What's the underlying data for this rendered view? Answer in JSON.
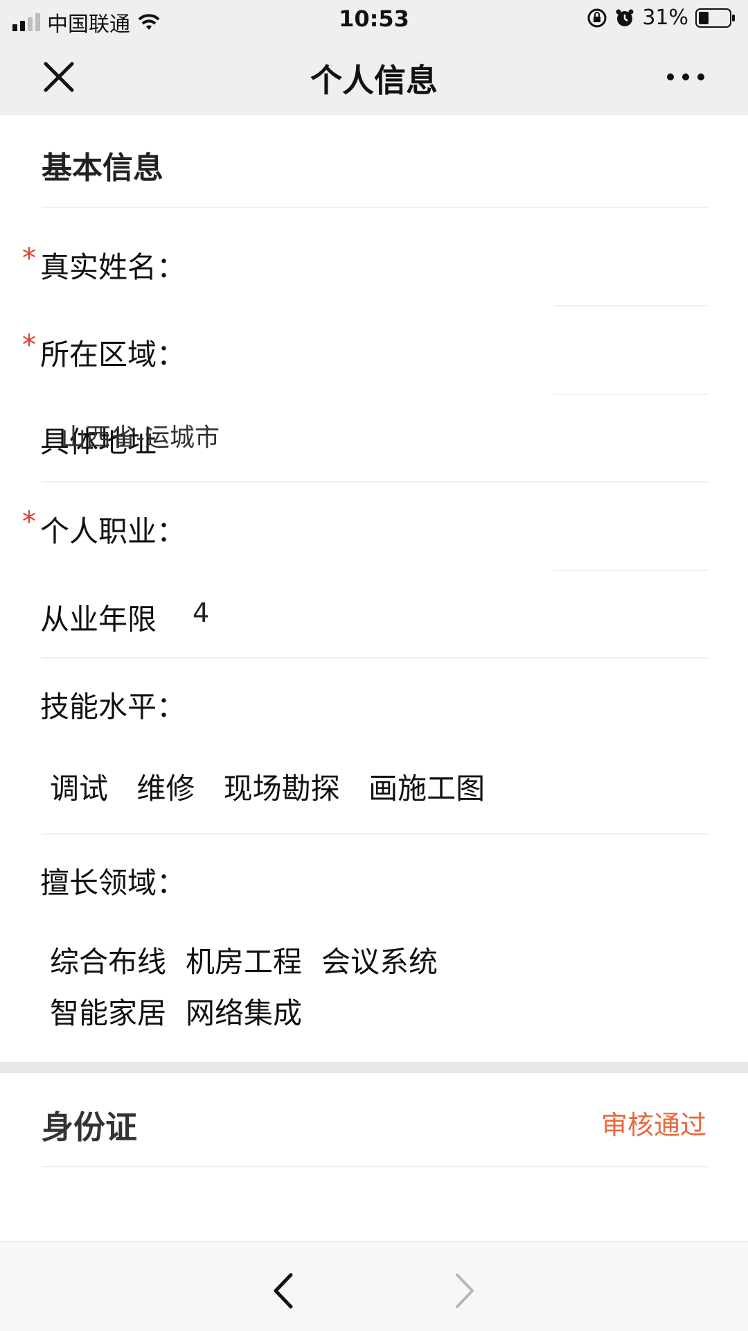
{
  "status_bar": {
    "carrier": "中国联通",
    "time": "10:53",
    "battery": "31%"
  },
  "nav": {
    "title": "个人信息"
  },
  "basic": {
    "section_title": "基本信息",
    "rows": [
      {
        "label": "真实姓名：",
        "value": "",
        "required": true
      },
      {
        "label": "所在区域：",
        "value": "",
        "required": true
      },
      {
        "label": "具体地址",
        "value": "山西省-运城市",
        "required": false
      },
      {
        "label": "个人职业：",
        "value": "",
        "required": true
      },
      {
        "label": "从业年限",
        "value": "4",
        "required": false
      }
    ],
    "skill_label": "技能水平：",
    "skills": [
      "调试",
      "维修",
      "现场勘探",
      "画施工图"
    ],
    "domain_label": "擅长领域：",
    "domains": [
      "综合布线",
      "机房工程",
      "会议系统",
      "智能家居",
      "网络集成"
    ]
  },
  "id_card": {
    "title": "身份证",
    "status": "审核通过",
    "status_color": "#e8693d"
  },
  "icons": {
    "close": "close-icon",
    "more": "more-icon",
    "back": "chevron-left-icon",
    "forward": "chevron-right-icon"
  }
}
